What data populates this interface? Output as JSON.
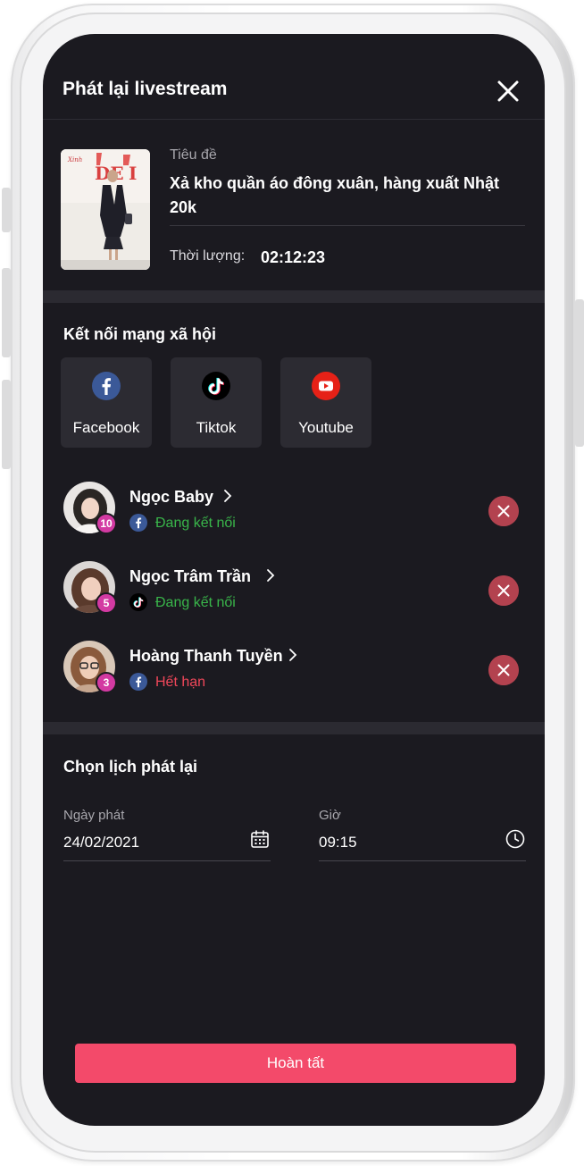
{
  "header": {
    "title": "Phát lại livestream"
  },
  "video": {
    "title_label": "Tiêu đề",
    "title": "Xả kho quần áo đông xuân, hàng xuất Nhật 20k",
    "duration_label": "Thời lượng:",
    "duration": "02:12:23"
  },
  "social": {
    "section_title": "Kết nối mạng xã hội",
    "networks": [
      {
        "label": "Facebook",
        "icon": "facebook-icon",
        "color": "#3b5998"
      },
      {
        "label": "Tiktok",
        "icon": "tiktok-icon",
        "color": "#000000"
      },
      {
        "label": "Youtube",
        "icon": "youtube-icon",
        "color": "#e62117"
      }
    ]
  },
  "accounts": [
    {
      "name": "Ngọc Baby",
      "badge": "10",
      "network_icon": "facebook-icon",
      "status": "Đang kết nối",
      "status_color": "#39b54a"
    },
    {
      "name": "Ngọc Trâm Trần",
      "badge": "5",
      "network_icon": "tiktok-icon",
      "status": "Đang kết nối",
      "status_color": "#39b54a"
    },
    {
      "name": "Hoàng Thanh Tuyền",
      "badge": "3",
      "network_icon": "facebook-icon",
      "status": "Hết hạn",
      "status_color": "#f0475a"
    }
  ],
  "schedule": {
    "section_title": "Chọn lịch phát lại",
    "date_label": "Ngày phát",
    "date_value": "24/02/2021",
    "time_label": "Giờ",
    "time_value": "09:15"
  },
  "submit_label": "Hoàn tất",
  "colors": {
    "accent": "#f34a6a",
    "background": "#1b1a20",
    "connected": "#39b54a",
    "expired": "#f0475a",
    "badge": "#d33aa2",
    "remove": "#b3424f"
  }
}
